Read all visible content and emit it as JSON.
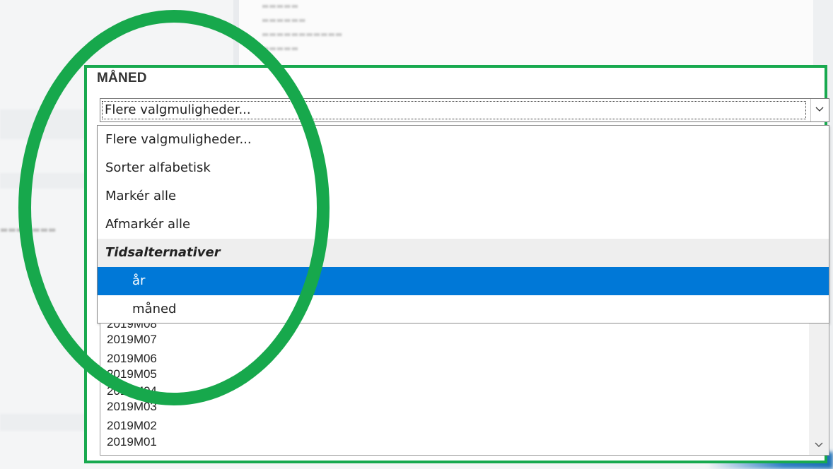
{
  "field": {
    "title": "MÅNED",
    "selected_value": "Flere valgmuligheder..."
  },
  "dropdown": {
    "items": [
      {
        "label": "Flere valgmuligheder..."
      },
      {
        "label": "Sorter alfabetisk"
      },
      {
        "label": "Markér alle"
      },
      {
        "label": "Afmarkér alle"
      },
      {
        "label": "Tidsalternativer"
      },
      {
        "label": "år"
      },
      {
        "label": "måned"
      }
    ]
  },
  "list": {
    "items": [
      "2019M08",
      "2019M07",
      "2019M06",
      "2019M05",
      "2019M04",
      "2019M03",
      "2019M02",
      "2019M01"
    ]
  },
  "icons": {
    "combo": "chevron-down-icon",
    "scroll": "chevron-down-icon"
  },
  "colors": {
    "highlight_ring": "#17a84c",
    "panel_border": "#18a94f",
    "selected_item": "#0078d7",
    "group_header_bg": "#eeeeee"
  }
}
